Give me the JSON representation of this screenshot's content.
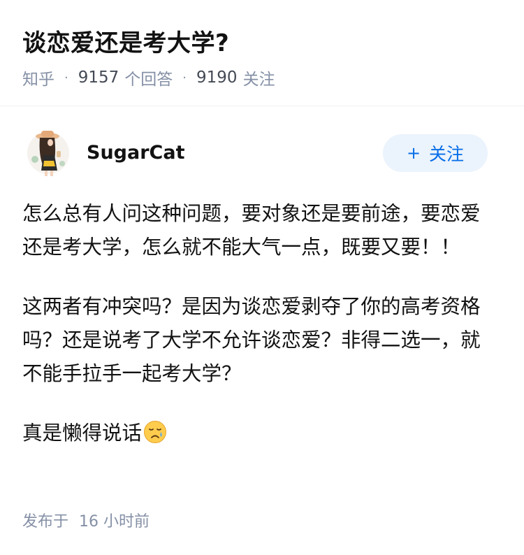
{
  "question": {
    "title": "谈恋爱还是考大学?",
    "source": "知乎",
    "answers_count": "9157",
    "answers_label": "个回答",
    "followers_count": "9190",
    "followers_label": "关注"
  },
  "answer": {
    "author": "SugarCat",
    "follow_label": "关注",
    "follow_plus": "+",
    "paragraphs": [
      "怎么总有人问这种问题，要对象还是要前途，要恋爱还是考大学，怎么就不能大气一点，既要又要！！",
      "这两者有冲突吗？是因为谈恋爱剥夺了你的高考资格吗？还是说考了大学不允许谈恋爱？非得二选一，就不能手拉手一起考大学？",
      "真是懒得说话"
    ],
    "emoji": "sad-relieved-face-icon",
    "posted_label": "发布于",
    "posted_time": "16 小时前"
  },
  "colors": {
    "accent": "#056de8",
    "follow_bg": "#ebf3fc",
    "meta_gray": "#8590a6"
  }
}
